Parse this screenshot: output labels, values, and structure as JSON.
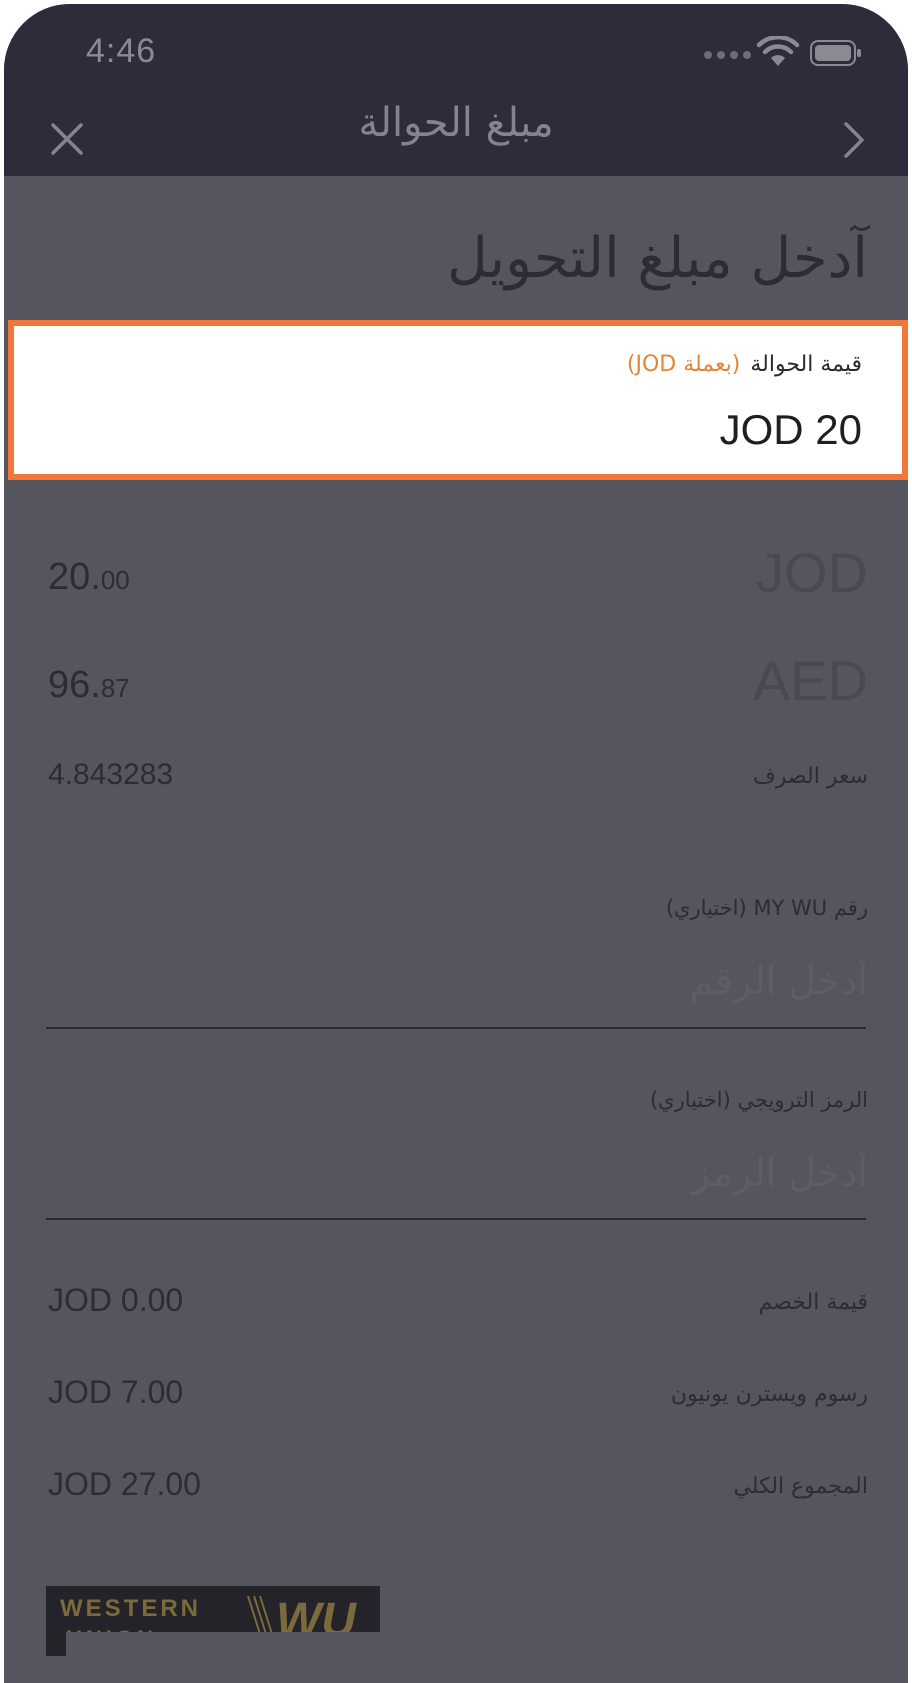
{
  "status_bar": {
    "time": "4:46"
  },
  "nav": {
    "title": "مبلغ الحوالة"
  },
  "headline": "آدخل مبلغ التحويل",
  "amount_field": {
    "label": "قيمة الحوالة",
    "currency_hint": "(بعملة JOD)",
    "value": "JOD 20"
  },
  "conversion": {
    "send": {
      "code": "JOD",
      "whole": "20.",
      "fraction": "00"
    },
    "receive": {
      "code": "AED",
      "whole": "96.",
      "fraction": "87"
    },
    "rate_label": "سعر الصرف",
    "rate_value": "4.843283"
  },
  "mywu_field": {
    "label": "رقم MY WU (اختياري)",
    "placeholder": "أدخل الرقم"
  },
  "promo_field": {
    "label": "الرمز الترويجي (اختياري)",
    "placeholder": "أدخل الرمز"
  },
  "summary": {
    "discount_label": "قيمة الخصم",
    "discount_value": "JOD 0.00",
    "fee_label": "رسوم ويسترن يونيون",
    "fee_value": "JOD 7.00",
    "total_label": "المجموع الكلي",
    "total_value": "JOD 27.00"
  },
  "logo": {
    "line1": "WESTERN",
    "line2": "UNION",
    "mark": "WU"
  },
  "colors": {
    "highlight": "#f0763a",
    "accent_text": "#e0873a",
    "dim_overlay": "#55555f",
    "nav_bar": "#2c2c3a"
  },
  "icons": {
    "close": "close-icon",
    "next": "chevron-right-icon",
    "wifi": "wifi-icon",
    "battery": "battery-icon",
    "signal": "signal-icon"
  }
}
